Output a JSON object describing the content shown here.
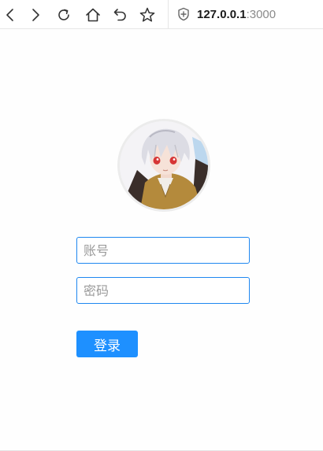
{
  "browser": {
    "url_host": "127.0.0.1",
    "url_port": ":3000",
    "icons": [
      "back-icon",
      "forward-icon",
      "reload-icon",
      "home-icon",
      "undo-icon",
      "bookmark-star-icon",
      "site-shield-icon"
    ]
  },
  "login": {
    "avatar_icon": "avatar-image",
    "account_placeholder": "账号",
    "password_placeholder": "密码",
    "submit_label": "登录"
  },
  "colors": {
    "accent": "#1e90ff",
    "input_border": "#1e87f0"
  }
}
